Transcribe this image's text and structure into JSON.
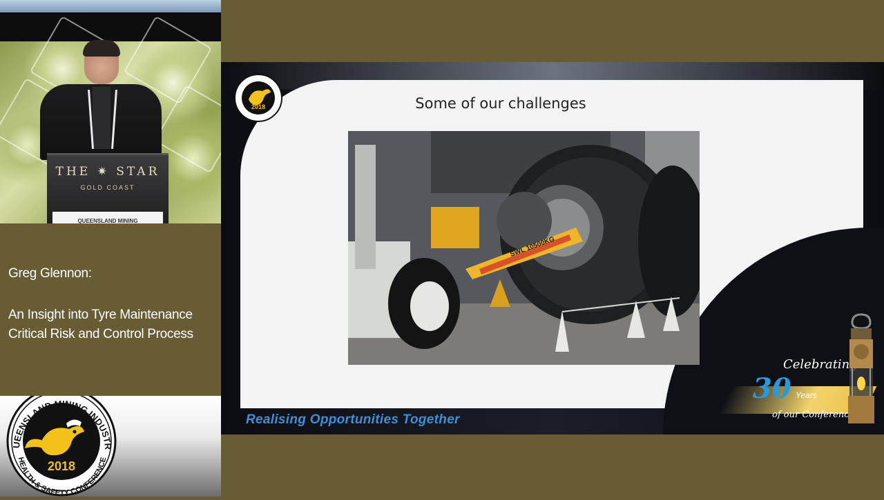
{
  "speaker_video": {
    "podium_logo": "THE ✷ STAR",
    "podium_sub": "GOLD COAST",
    "podium_banner": "QUEENSLAND MINING"
  },
  "speaker": {
    "name": "Greg Glennon:",
    "talk_title_line1": "An Insight into Tyre Maintenance",
    "talk_title_line2": "Critical Risk and Control Process"
  },
  "badge": {
    "top_text": "QUEENSLAND MINING INDUSTRY",
    "bottom_text": "HEALTH & SAFETY CONFERENCE",
    "year": "2018"
  },
  "slide": {
    "title": "Some of our challenges",
    "tagline": "Realising Opportunities Together",
    "photo_label": "SWL 10500KG",
    "celebrating": "Celebrating",
    "celebrating_number": "30",
    "celebrating_years": "Years",
    "celebrating_conf": "of our Conference"
  },
  "colors": {
    "background": "#675c33",
    "tagline_blue": "#3f8fd6",
    "badge_yellow": "#f2c21b"
  }
}
